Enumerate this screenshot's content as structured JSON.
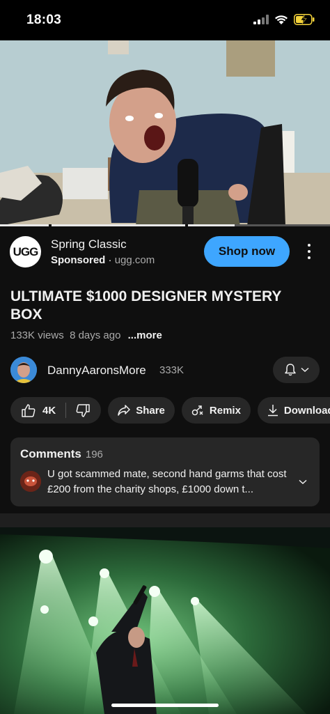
{
  "status_bar": {
    "time": "18:03"
  },
  "ad": {
    "logo_text": "UGG",
    "title": "Spring Classic",
    "sponsored_label": "Sponsored",
    "separator": "·",
    "domain": "ugg.com",
    "cta_label": "Shop now",
    "cta_color": "#3ea6ff"
  },
  "video": {
    "progress_fraction": 0.71,
    "title": "ULTIMATE $1000 DESIGNER MYSTERY BOX",
    "views": "133K views",
    "age": "8 days ago",
    "more_label": "...more"
  },
  "channel": {
    "name": "DannyAaronsMore",
    "subscribers": "333K"
  },
  "actions": {
    "likes": "4K",
    "share_label": "Share",
    "remix_label": "Remix",
    "download_label": "Download"
  },
  "comments": {
    "heading": "Comments",
    "count": "196",
    "top_comment": "U got scammed mate, second hand garms that cost £200 from the charity shops, £1000 down t..."
  },
  "icons": [
    "signal-icon",
    "wifi-icon",
    "battery-charging-icon",
    "kebab-menu-icon",
    "bell-icon",
    "chevron-down-icon",
    "thumbs-up-icon",
    "thumbs-down-icon",
    "share-icon",
    "remix-icon",
    "download-icon"
  ]
}
